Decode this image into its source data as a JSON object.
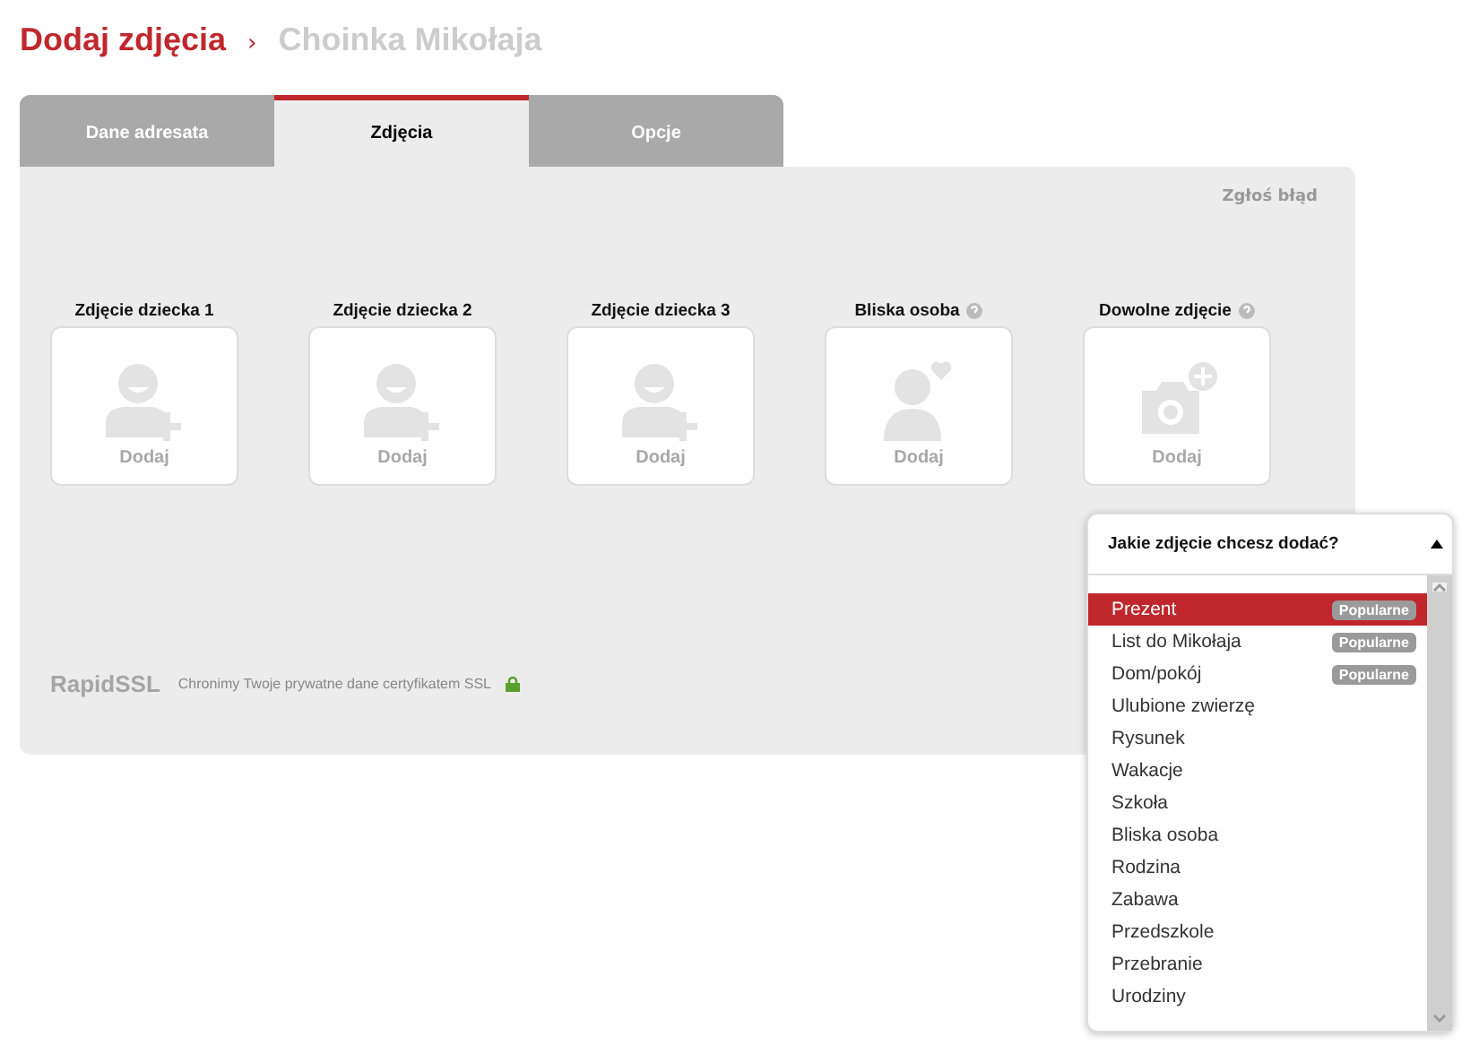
{
  "header": {
    "title": "Dodaj zdjęcia",
    "separator": "›",
    "subtitle": "Choinka Mikołaja"
  },
  "tabs": [
    {
      "label": "Dane adresata",
      "selected": false
    },
    {
      "label": "Zdjęcia",
      "selected": true
    },
    {
      "label": "Opcje",
      "selected": false
    }
  ],
  "report_link": "Zgłoś błąd",
  "slots": [
    {
      "label": "Zdjęcie dziecka 1",
      "kind": "child",
      "help": false,
      "action": "Dodaj"
    },
    {
      "label": "Zdjęcie dziecka 2",
      "kind": "child",
      "help": false,
      "action": "Dodaj"
    },
    {
      "label": "Zdjęcie dziecka 3",
      "kind": "child",
      "help": false,
      "action": "Dodaj"
    },
    {
      "label": "Bliska osoba",
      "kind": "person",
      "help": true,
      "action": "Dodaj"
    },
    {
      "label": "Dowolne zdjęcie",
      "kind": "camera",
      "help": true,
      "action": "Dodaj"
    }
  ],
  "footer": {
    "ssl_logo": "RapidSSL",
    "ssl_text": "Chronimy Twoje prywatne dane certyfikatem SSL"
  },
  "dropdown": {
    "title": "Jakie zdjęcie chcesz dodać?",
    "expanded": true,
    "options": [
      {
        "label": "Prezent",
        "badge": "Popularne",
        "selected": true
      },
      {
        "label": "List do Mikołaja",
        "badge": "Popularne",
        "selected": false
      },
      {
        "label": "Dom/pokój",
        "badge": "Popularne",
        "selected": false
      },
      {
        "label": "Ulubione zwierzę",
        "selected": false
      },
      {
        "label": "Rysunek",
        "selected": false
      },
      {
        "label": "Wakacje",
        "selected": false
      },
      {
        "label": "Szkoła",
        "selected": false
      },
      {
        "label": "Bliska osoba",
        "selected": false
      },
      {
        "label": "Rodzina",
        "selected": false
      },
      {
        "label": "Zabawa",
        "selected": false
      },
      {
        "label": "Przedszkole",
        "selected": false
      },
      {
        "label": "Przebranie",
        "selected": false
      },
      {
        "label": "Urodziny",
        "selected": false
      }
    ]
  }
}
